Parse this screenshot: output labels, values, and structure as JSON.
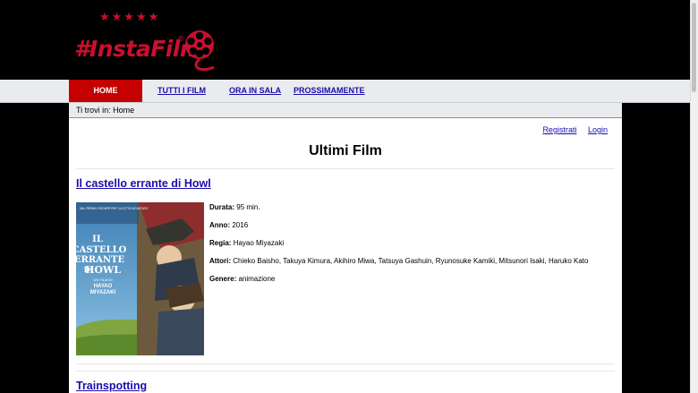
{
  "brand": {
    "stars": "★★★★★",
    "name": "#InstaFilm",
    "reg": "®"
  },
  "nav": {
    "home": "HOME",
    "all_films": "TUTTI I FILM",
    "now_showing": "ORA IN SALA",
    "coming_soon": "PROSSIMAMENTE"
  },
  "breadcrumb": "Ti trovi in: Home",
  "auth": {
    "register": "Registrati",
    "login": "Login"
  },
  "page_title": "Ultimi Film",
  "films": [
    {
      "title": "Il castello errante di Howl",
      "poster": {
        "top_text": "DAL PREMIO OSCAR® PER \"LA CITTÀ INCANTATA\"",
        "title_line1": "IL",
        "title_line2": "CASTELLO",
        "title_line3": "ERRANTE",
        "title_line4": "DI",
        "title_line5": "HOWL",
        "director_line1": "UN FILM DI",
        "director_line2": "HAYAO",
        "director_line3": "MIYAZAKI"
      },
      "duration_label": "Durata:",
      "duration": "95 min.",
      "year_label": "Anno:",
      "year": "2016",
      "director_label": "Regia:",
      "director": "Hayao Miyazaki",
      "actors_label": "Attori:",
      "actors": "Chieko Baisho, Takuya Kimura, Akihiro Miwa, Tatsuya Gashuin, Ryunosuke Kamiki, Mitsunori Isaki, Haruko Kato",
      "genre_label": "Genere:",
      "genre": "animazione"
    },
    {
      "title": "Trainspotting"
    }
  ],
  "colors": {
    "brand_red": "#c8102e",
    "nav_active": "#c40000",
    "link": "#1a0dab"
  }
}
